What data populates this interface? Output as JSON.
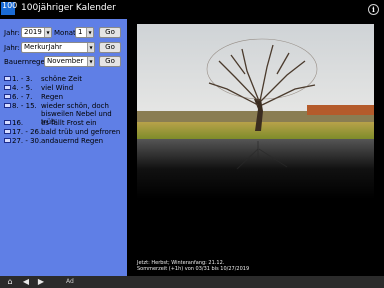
{
  "app": {
    "icon_text": "100",
    "title": "100jähriger Kalender",
    "info_icon": "info-icon"
  },
  "controls": {
    "year_label": "Jahr:",
    "year_value": "2019",
    "month_label": "Monat:",
    "month_value": "1",
    "go_label": "Go",
    "jahr_label": "Jahr:",
    "jahr_value": "MerkurJahr",
    "bauern_label": "Bauernregeln:",
    "bauern_value": "November"
  },
  "weather_list": [
    {
      "range": "1. - 3.",
      "desc": "schöne Zeit"
    },
    {
      "range": "4. - 5.",
      "desc": "viel Wind"
    },
    {
      "range": "6. - 7.",
      "desc": "Regen"
    },
    {
      "range": "8. - 15.",
      "desc": "wieder schön, doch bisweilen Nebel und trüb"
    },
    {
      "range": "16.",
      "desc": "es fällt Frost ein"
    },
    {
      "range": "17. - 26.",
      "desc": "bald trüb und gefroren"
    },
    {
      "range": "27. - 30.",
      "desc": "andauernd Regen"
    }
  ],
  "status": {
    "line1": "Jetzt: Herbst; Winteranfang: 21.12.",
    "line2": "Sommerzeit (+1h) von 03/31 bis 10/27/2019"
  },
  "bottombar": {
    "home": "home-icon",
    "back": "back-icon",
    "forward": "forward-icon",
    "ad": "Ad"
  },
  "colors": {
    "sidebar": "#5f7fe6",
    "background": "#000000",
    "accent": "#1a6bd6"
  }
}
